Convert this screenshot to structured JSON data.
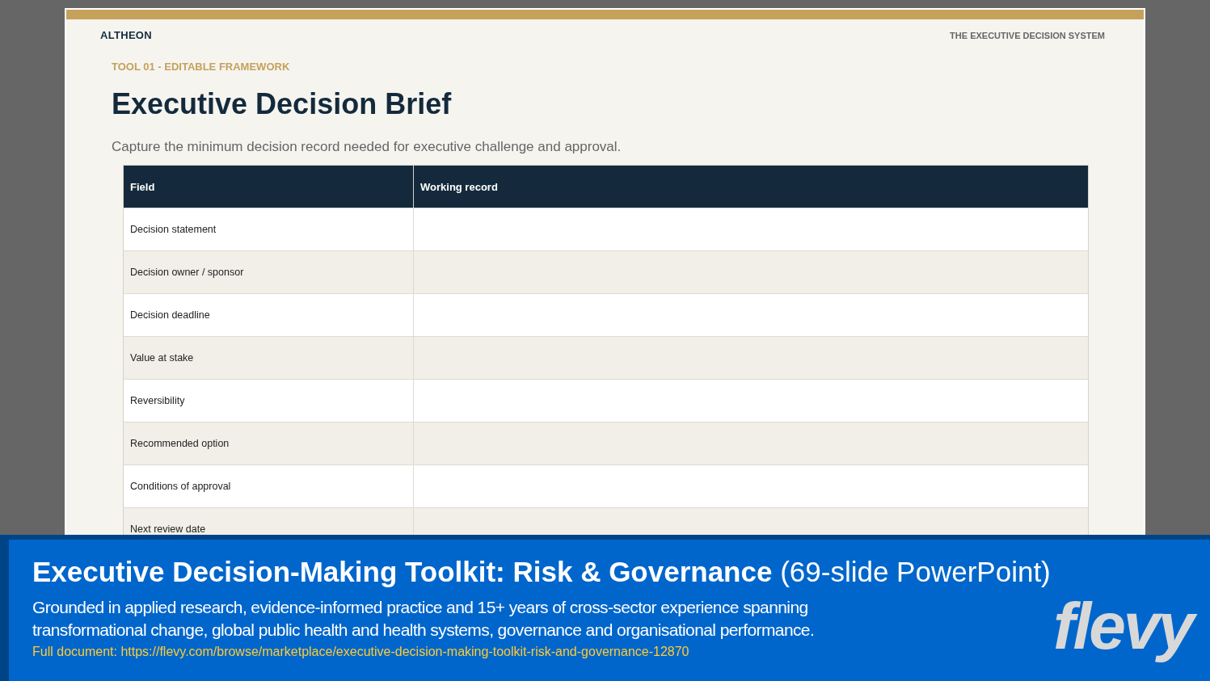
{
  "slide": {
    "brand": "ALTHEON",
    "system": "THE EXECUTIVE DECISION SYSTEM",
    "eyebrow": "TOOL 01 - EDITABLE FRAMEWORK",
    "title": "Executive Decision Brief",
    "subtitle": "Capture the minimum decision record needed for executive challenge and approval.",
    "table": {
      "columns": [
        "Field",
        "Working record"
      ],
      "rows": [
        {
          "field": "Decision statement"
        },
        {
          "field": "Decision owner / sponsor"
        },
        {
          "field": "Decision deadline"
        },
        {
          "field": "Value at stake"
        },
        {
          "field": "Reversibility"
        },
        {
          "field": "Recommended option"
        },
        {
          "field": "Conditions of approval"
        },
        {
          "field": "Next review date"
        }
      ]
    }
  },
  "banner": {
    "title": "Executive Decision-Making Toolkit: Risk & Governance",
    "title_note": "(69-slide PowerPoint)",
    "description": "Grounded in applied research, evidence-informed practice and 15+ years of cross-sector experience spanning transformational change, global public health and health systems, governance and organisational performance.",
    "link_label": "Full document:",
    "link": "https://flevy.com/browse/marketplace/executive-decision-making-toolkit-risk-and-governance-12870",
    "logo": "flevy"
  }
}
